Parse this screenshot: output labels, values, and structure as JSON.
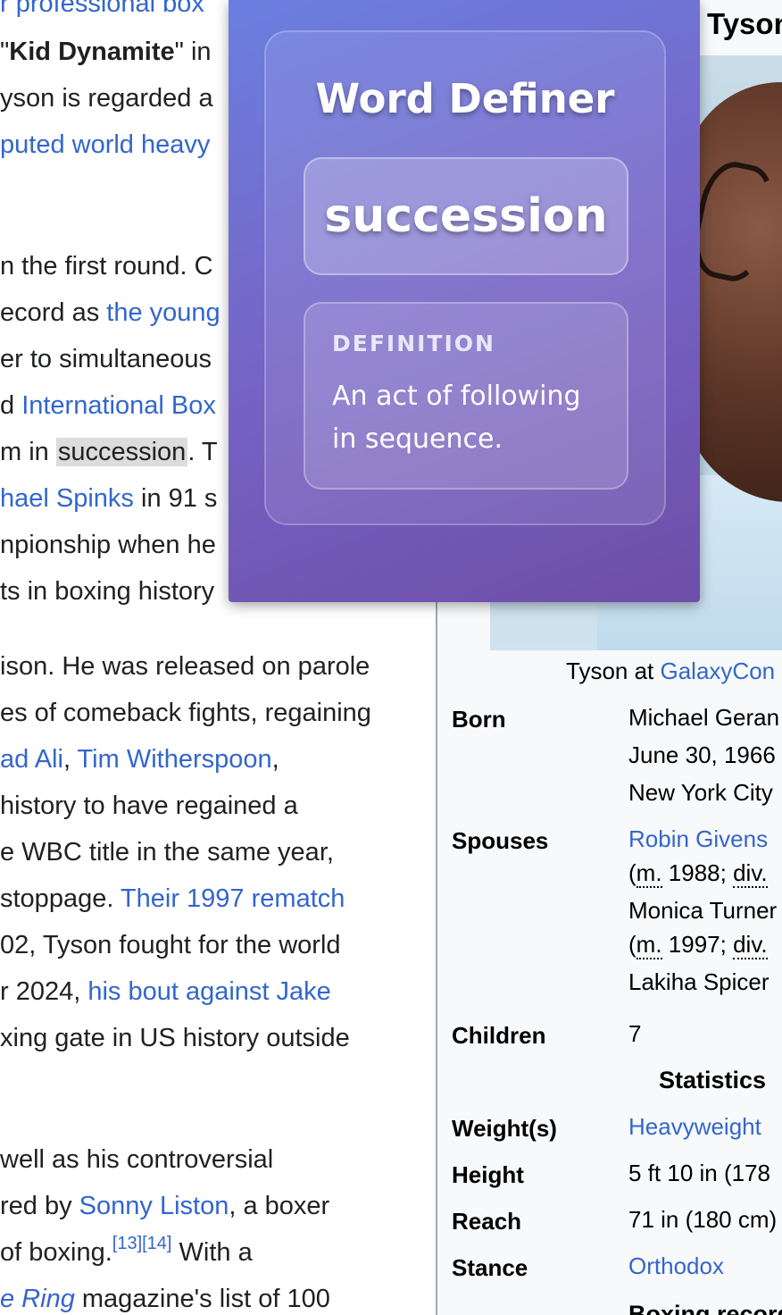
{
  "article": {
    "l1": "r professional box",
    "l2a": "\"",
    "l2b": "Kid Dynamite",
    "l2c": "\" in",
    "l3": "yson is regarded a",
    "l4": "puted world heavy",
    "l5": "n the first round. C",
    "l6a": "ecord as ",
    "l6b": "the young",
    "l7": "er to simultaneous",
    "l8a": "d ",
    "l8b": "International Box",
    "l9a": "m in ",
    "l9b": "succession",
    "l9c": ". T",
    "l10a": "hael Spinks",
    "l10b": " in 91 s",
    "l11": "npionship when he",
    "l12": "ts in boxing history",
    "l13": "ison. He was released on parole",
    "l14": "es of comeback fights, regaining",
    "l15a": "ad Ali",
    "l15b": ", ",
    "l15c": "Tim Witherspoon",
    "l15d": ",",
    "l16": " history to have regained a",
    "l17": "e WBC title in the same year,",
    "l18a": " stoppage. ",
    "l18b": "Their 1997 rematch",
    "l19": "02, Tyson fought for the world",
    "l20a": "r 2024, ",
    "l20b": "his bout against Jake",
    "l21": "xing gate in US history outside",
    "l22": " well as his controversial",
    "l23a": "red by ",
    "l23b": "Sonny Liston",
    "l23c": ", a boxer",
    "l24a": "of boxing.",
    "l24b": "[13][14]",
    "l24c": " With a",
    "l25a": "e Ring",
    "l25b": " magazine's list of 100"
  },
  "infobox": {
    "title": "Tyson",
    "caption_a": "Tyson at ",
    "caption_b": "GalaxyCon",
    "born_label": "Born",
    "born_1": "Michael Geran",
    "born_2": "June 30, 1966",
    "born_3": "New York City",
    "spouses_label": "Spouses",
    "spouse_1": "Robin Givens",
    "spouse_1_a": "(",
    "spouse_1_m": "m.",
    "spouse_1_b": " 1988; ",
    "spouse_1_div": "div.",
    "spouse_2": "Monica Turner",
    "spouse_2_a": "(",
    "spouse_2_m": "m.",
    "spouse_2_b": " 1997; ",
    "spouse_2_div": "div.",
    "spouse_3": "Lakiha Spicer",
    "children_label": "Children",
    "children_val": "7",
    "stats_header": "Statistics",
    "weight_label": "Weight(s)",
    "weight_val": "Heavyweight",
    "height_label": "Height",
    "height_val": "5 ft 10 in (178",
    "reach_label": "Reach",
    "reach_val": "71 in (180 cm)",
    "stance_label": "Stance",
    "stance_val": "Orthodox",
    "record_header": "Boxing record"
  },
  "popup": {
    "title": "Word Definer",
    "word": "succession",
    "definition_label": "DEFINITION",
    "definition_text": "An act of following in sequence."
  },
  "colors": {
    "link": "#3366cc",
    "popup_gradient_start": "#6b7fe0",
    "popup_gradient_end": "#6e4ea8",
    "highlight": "#dcdcdc"
  }
}
